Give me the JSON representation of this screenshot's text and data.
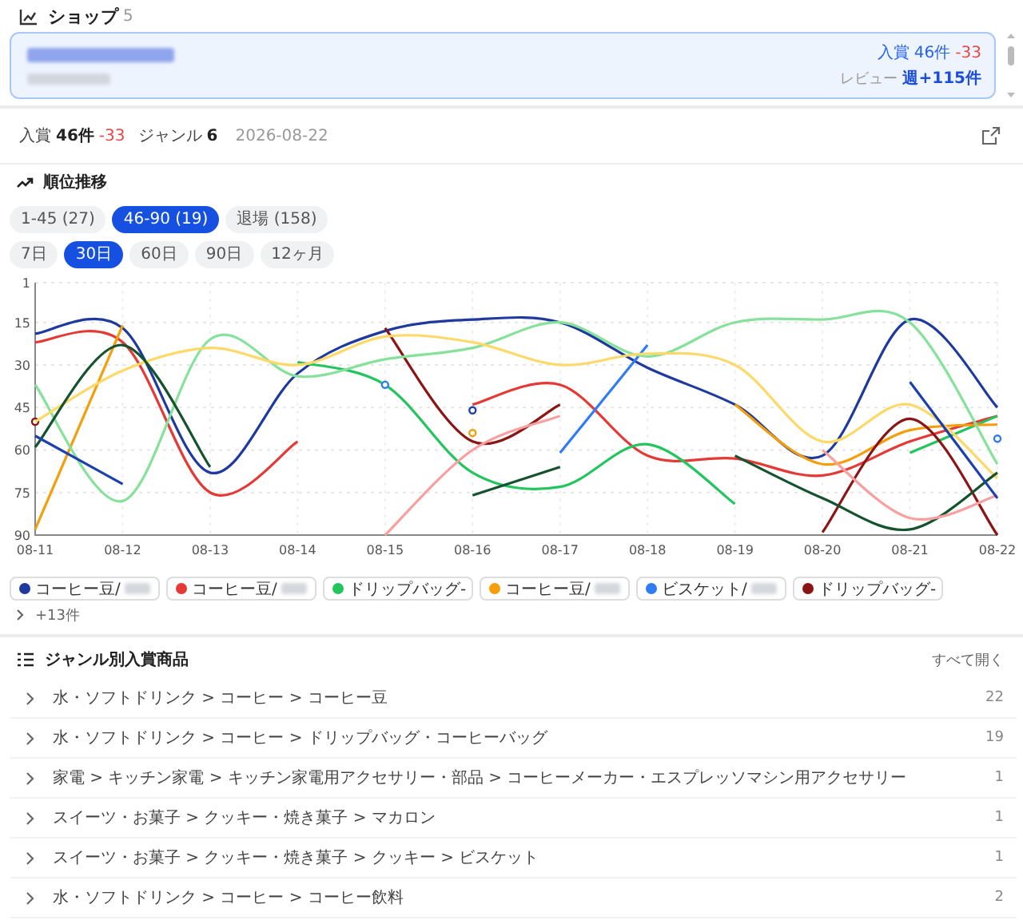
{
  "header": {
    "title": "ショップ",
    "count": "5"
  },
  "shop_card": {
    "stat_label": "入賞",
    "stat_value": "46件",
    "stat_delta": "-33",
    "review_label": "レビュー",
    "review_value": "週+115件"
  },
  "summary": {
    "items": [
      {
        "label": "入賞",
        "value": "46件",
        "delta": "-33"
      },
      {
        "label": "ジャンル",
        "value": "6"
      }
    ],
    "date": "2026-08-22"
  },
  "rank_section": {
    "title": "順位推移",
    "range_chips": [
      {
        "label": "1-45 (27)",
        "selected": false
      },
      {
        "label": "46-90 (19)",
        "selected": true
      },
      {
        "label": "退場 (158)",
        "selected": false
      }
    ],
    "period_chips": [
      {
        "label": "7日",
        "selected": false
      },
      {
        "label": "30日",
        "selected": true
      },
      {
        "label": "60日",
        "selected": false
      },
      {
        "label": "90日",
        "selected": false
      },
      {
        "label": "12ヶ月",
        "selected": false
      }
    ],
    "chart_data": {
      "type": "line",
      "grid": true,
      "categories": [
        "08-11",
        "08-12",
        "08-13",
        "08-14",
        "08-15",
        "08-16",
        "08-17",
        "08-18",
        "08-19",
        "08-20",
        "08-21",
        "08-22"
      ],
      "ylim": [
        90,
        1
      ],
      "yticks": [
        1,
        15,
        30,
        45,
        60,
        75,
        90
      ],
      "series": [
        {
          "name": "コーヒー豆/",
          "color": "#1f3a9e",
          "values": [
            19,
            17,
            68,
            33,
            18,
            14,
            15,
            31,
            44,
            62,
            14,
            45
          ]
        },
        {
          "name": "コーヒー豆/",
          "color": "#e53935",
          "values": [
            22,
            22,
            75,
            57,
            null,
            44,
            37,
            62,
            63,
            69,
            57,
            48
          ]
        },
        {
          "name": "ドリップバッグ-",
          "color": "#22c55e",
          "values": [
            null,
            null,
            null,
            29,
            37,
            68,
            73,
            58,
            79,
            null,
            61,
            48
          ]
        },
        {
          "name": "コーヒー豆/",
          "color": "#f59e0b",
          "values": [
            88,
            16,
            null,
            null,
            null,
            54,
            null,
            null,
            44,
            65,
            53,
            51
          ]
        },
        {
          "name": "ビスケット/",
          "color": "#2f7cf6",
          "values": [
            null,
            null,
            null,
            null,
            37,
            null,
            61,
            23,
            null,
            null,
            null,
            56
          ]
        },
        {
          "name": "ドリップバッグ-",
          "color": "#8b1414",
          "values": [
            50,
            null,
            null,
            null,
            17,
            57,
            44,
            null,
            null,
            89,
            49,
            90
          ]
        },
        {
          "color": "#86e29b",
          "values": [
            37,
            78,
            21,
            34,
            28,
            24,
            15,
            27,
            15,
            14,
            15,
            65
          ]
        },
        {
          "color": "#fcd968",
          "values": [
            50,
            32,
            24,
            30,
            20,
            22,
            30,
            26,
            30,
            57,
            44,
            70
          ]
        },
        {
          "color": "#14532d",
          "values": [
            59,
            23,
            66,
            null,
            null,
            76,
            66,
            null,
            62,
            77,
            88,
            68
          ]
        },
        {
          "color": "#f8a0a0",
          "values": [
            null,
            null,
            null,
            null,
            90,
            60,
            48,
            null,
            null,
            60,
            84,
            76
          ]
        },
        {
          "color": "#1e40af",
          "values": [
            55,
            72,
            null,
            null,
            null,
            46,
            null,
            null,
            null,
            null,
            36,
            77
          ]
        }
      ]
    },
    "more": "+13件"
  },
  "genre_section": {
    "title": "ジャンル別入賞商品",
    "expand_all": "すべて開く",
    "rows": [
      {
        "path": "水・ソフトドリンク > コーヒー > コーヒー豆",
        "count": "22"
      },
      {
        "path": "水・ソフトドリンク > コーヒー > ドリップバッグ・コーヒーバッグ",
        "count": "19"
      },
      {
        "path": "家電 > キッチン家電 > キッチン家電用アクセサリー・部品 > コーヒーメーカー・エスプレッソマシン用アクセサリー",
        "count": "1"
      },
      {
        "path": "スイーツ・お菓子 > クッキー・焼き菓子 > マカロン",
        "count": "1"
      },
      {
        "path": "スイーツ・お菓子 > クッキー・焼き菓子 > クッキー > ビスケット",
        "count": "1"
      },
      {
        "path": "水・ソフトドリンク > コーヒー > コーヒー飲料",
        "count": "2"
      }
    ]
  }
}
